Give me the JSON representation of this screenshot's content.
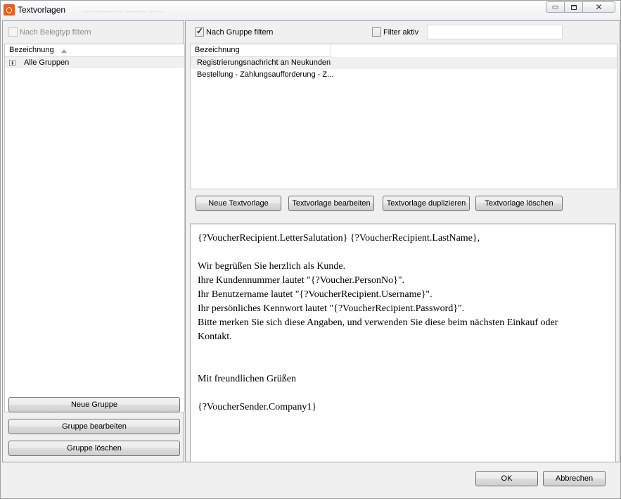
{
  "window": {
    "title": "Textvorlagen",
    "ghost_title": "________  ____  ___",
    "minimize_glyph": "▭",
    "close_glyph": "✕"
  },
  "left": {
    "belegtyp_filter_label": "Nach Belegtyp filtern",
    "belegtyp_filter_checked": false,
    "tree_header": "Bezeichnung",
    "tree_items": [
      {
        "label": "Alle Gruppen",
        "expandable": true
      }
    ],
    "buttons": {
      "new_group": "Neue Gruppe",
      "edit_group": "Gruppe bearbeiten",
      "delete_group": "Gruppe löschen"
    }
  },
  "right": {
    "group_filter_label": "Nach Gruppe filtern",
    "group_filter_checked": true,
    "filter_active_label": "Filter aktiv",
    "filter_active_checked": false,
    "filter_value": "",
    "list_header": "Bezeichnung",
    "templates": [
      {
        "label": "Registrierungsnachricht an Neukunden",
        "selected": true
      },
      {
        "label": "Bestellung - Zahlungsaufforderung - Z...",
        "selected": false
      }
    ],
    "buttons": {
      "new_template": "Neue Textvorlage",
      "edit_template": "Textvorlage bearbeiten",
      "duplicate_template": "Textvorlage duplizieren",
      "delete_template": "Textvorlage löschen"
    },
    "preview_lines": [
      "{?VoucherRecipient.LetterSalutation} {?VoucherRecipient.LastName},",
      "",
      "Wir begrüßen Sie herzlich als Kunde.",
      "Ihre Kundennummer lautet \"{?Voucher.PersonNo}\".",
      "Ihr Benutzername lautet \"{?VoucherRecipient.Username}\".",
      "Ihr persönliches Kennwort lautet \"{?VoucherRecipient.Password}\".",
      "Bitte merken Sie sich diese Angaben, und verwenden Sie diese beim nächsten Einkauf oder",
      "Kontakt.",
      "",
      "",
      "Mit freundlichen Grüßen",
      "",
      "{?VoucherSender.Company1}"
    ]
  },
  "footer": {
    "ok": "OK",
    "cancel": "Abbrechen"
  }
}
